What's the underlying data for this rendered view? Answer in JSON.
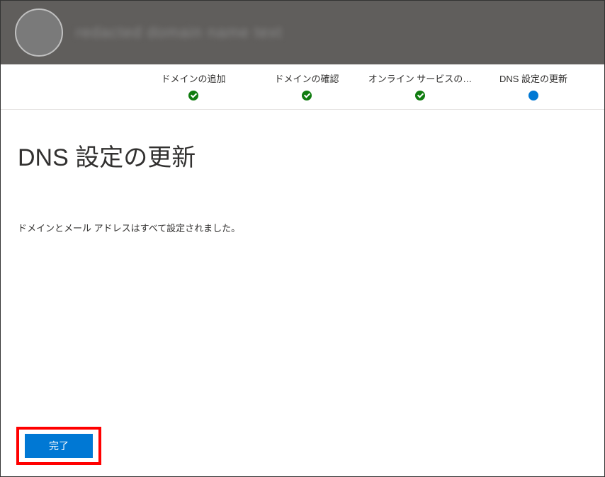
{
  "header": {
    "title_obscured": "redacted domain name text"
  },
  "steps": [
    {
      "label": "ドメインの追加",
      "state": "complete"
    },
    {
      "label": "ドメインの確認",
      "state": "complete"
    },
    {
      "label": "オンライン サービスの…",
      "state": "complete"
    },
    {
      "label": "DNS 設定の更新",
      "state": "active"
    }
  ],
  "main": {
    "title": "DNS 設定の更新",
    "message": "ドメインとメール アドレスはすべて設定されました。"
  },
  "footer": {
    "finish_label": "完了"
  },
  "colors": {
    "accent": "#0078d4",
    "success": "#107c10",
    "highlight": "#ff0000",
    "header_bg": "#605e5c"
  }
}
